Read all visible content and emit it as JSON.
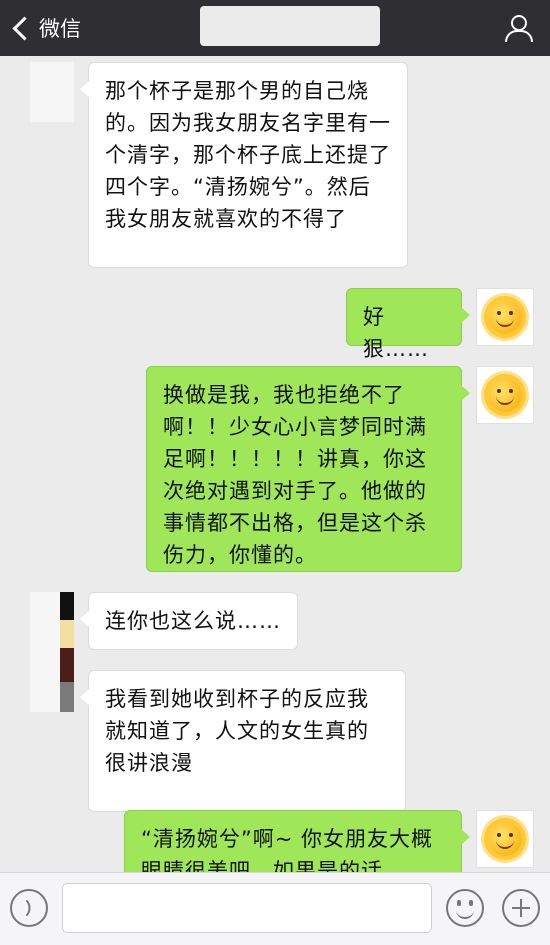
{
  "header": {
    "back_label": "微信"
  },
  "messages": [
    {
      "side": "left",
      "text": "那个杯子是那个男的自己烧的。因为我女朋友名字里有一个清字，那个杯子底上还提了四个字。“清扬婉兮”。然后我女朋友就喜欢的不得了"
    },
    {
      "side": "right",
      "text": "好狠……"
    },
    {
      "side": "right",
      "text": "换做是我，我也拒绝不了啊！！少女心小言梦同时满足啊！！！！！讲真，你这次绝对遇到对手了。他做的事情都不出格，但是这个杀伤力，你懂的。"
    },
    {
      "side": "left",
      "text": "连你也这么说……"
    },
    {
      "side": "left",
      "text": "我看到她收到杯子的反应我就知道了，人文的女生真的很讲浪漫"
    },
    {
      "side": "right",
      "text": "“清扬婉兮”啊~ 你女朋友大概眼睛很美吧，如果是的话"
    }
  ],
  "colors": {
    "header_bg": "#2e2e33",
    "chat_bg": "#ebebeb",
    "bubble_left": "#ffffff",
    "bubble_right": "#9fe658"
  },
  "icons": {
    "back": "chevron-left-icon",
    "profile": "person-icon",
    "voice": "voice-icon",
    "emoji": "emoji-icon",
    "more": "plus-icon"
  }
}
